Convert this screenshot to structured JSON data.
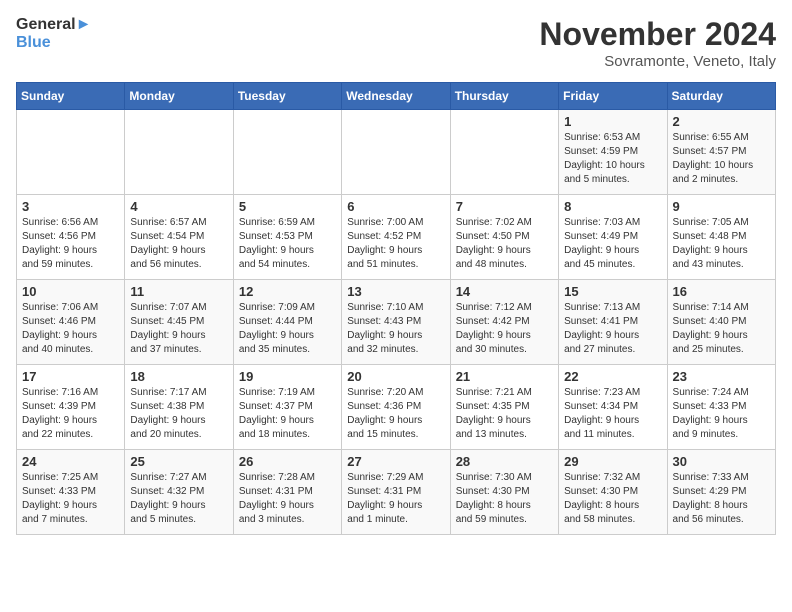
{
  "logo": {
    "line1": "General",
    "line2": "Blue"
  },
  "title": "November 2024",
  "subtitle": "Sovramonte, Veneto, Italy",
  "days_header": [
    "Sunday",
    "Monday",
    "Tuesday",
    "Wednesday",
    "Thursday",
    "Friday",
    "Saturday"
  ],
  "weeks": [
    [
      {
        "day": "",
        "info": ""
      },
      {
        "day": "",
        "info": ""
      },
      {
        "day": "",
        "info": ""
      },
      {
        "day": "",
        "info": ""
      },
      {
        "day": "",
        "info": ""
      },
      {
        "day": "1",
        "info": "Sunrise: 6:53 AM\nSunset: 4:59 PM\nDaylight: 10 hours\nand 5 minutes."
      },
      {
        "day": "2",
        "info": "Sunrise: 6:55 AM\nSunset: 4:57 PM\nDaylight: 10 hours\nand 2 minutes."
      }
    ],
    [
      {
        "day": "3",
        "info": "Sunrise: 6:56 AM\nSunset: 4:56 PM\nDaylight: 9 hours\nand 59 minutes."
      },
      {
        "day": "4",
        "info": "Sunrise: 6:57 AM\nSunset: 4:54 PM\nDaylight: 9 hours\nand 56 minutes."
      },
      {
        "day": "5",
        "info": "Sunrise: 6:59 AM\nSunset: 4:53 PM\nDaylight: 9 hours\nand 54 minutes."
      },
      {
        "day": "6",
        "info": "Sunrise: 7:00 AM\nSunset: 4:52 PM\nDaylight: 9 hours\nand 51 minutes."
      },
      {
        "day": "7",
        "info": "Sunrise: 7:02 AM\nSunset: 4:50 PM\nDaylight: 9 hours\nand 48 minutes."
      },
      {
        "day": "8",
        "info": "Sunrise: 7:03 AM\nSunset: 4:49 PM\nDaylight: 9 hours\nand 45 minutes."
      },
      {
        "day": "9",
        "info": "Sunrise: 7:05 AM\nSunset: 4:48 PM\nDaylight: 9 hours\nand 43 minutes."
      }
    ],
    [
      {
        "day": "10",
        "info": "Sunrise: 7:06 AM\nSunset: 4:46 PM\nDaylight: 9 hours\nand 40 minutes."
      },
      {
        "day": "11",
        "info": "Sunrise: 7:07 AM\nSunset: 4:45 PM\nDaylight: 9 hours\nand 37 minutes."
      },
      {
        "day": "12",
        "info": "Sunrise: 7:09 AM\nSunset: 4:44 PM\nDaylight: 9 hours\nand 35 minutes."
      },
      {
        "day": "13",
        "info": "Sunrise: 7:10 AM\nSunset: 4:43 PM\nDaylight: 9 hours\nand 32 minutes."
      },
      {
        "day": "14",
        "info": "Sunrise: 7:12 AM\nSunset: 4:42 PM\nDaylight: 9 hours\nand 30 minutes."
      },
      {
        "day": "15",
        "info": "Sunrise: 7:13 AM\nSunset: 4:41 PM\nDaylight: 9 hours\nand 27 minutes."
      },
      {
        "day": "16",
        "info": "Sunrise: 7:14 AM\nSunset: 4:40 PM\nDaylight: 9 hours\nand 25 minutes."
      }
    ],
    [
      {
        "day": "17",
        "info": "Sunrise: 7:16 AM\nSunset: 4:39 PM\nDaylight: 9 hours\nand 22 minutes."
      },
      {
        "day": "18",
        "info": "Sunrise: 7:17 AM\nSunset: 4:38 PM\nDaylight: 9 hours\nand 20 minutes."
      },
      {
        "day": "19",
        "info": "Sunrise: 7:19 AM\nSunset: 4:37 PM\nDaylight: 9 hours\nand 18 minutes."
      },
      {
        "day": "20",
        "info": "Sunrise: 7:20 AM\nSunset: 4:36 PM\nDaylight: 9 hours\nand 15 minutes."
      },
      {
        "day": "21",
        "info": "Sunrise: 7:21 AM\nSunset: 4:35 PM\nDaylight: 9 hours\nand 13 minutes."
      },
      {
        "day": "22",
        "info": "Sunrise: 7:23 AM\nSunset: 4:34 PM\nDaylight: 9 hours\nand 11 minutes."
      },
      {
        "day": "23",
        "info": "Sunrise: 7:24 AM\nSunset: 4:33 PM\nDaylight: 9 hours\nand 9 minutes."
      }
    ],
    [
      {
        "day": "24",
        "info": "Sunrise: 7:25 AM\nSunset: 4:33 PM\nDaylight: 9 hours\nand 7 minutes."
      },
      {
        "day": "25",
        "info": "Sunrise: 7:27 AM\nSunset: 4:32 PM\nDaylight: 9 hours\nand 5 minutes."
      },
      {
        "day": "26",
        "info": "Sunrise: 7:28 AM\nSunset: 4:31 PM\nDaylight: 9 hours\nand 3 minutes."
      },
      {
        "day": "27",
        "info": "Sunrise: 7:29 AM\nSunset: 4:31 PM\nDaylight: 9 hours\nand 1 minute."
      },
      {
        "day": "28",
        "info": "Sunrise: 7:30 AM\nSunset: 4:30 PM\nDaylight: 8 hours\nand 59 minutes."
      },
      {
        "day": "29",
        "info": "Sunrise: 7:32 AM\nSunset: 4:30 PM\nDaylight: 8 hours\nand 58 minutes."
      },
      {
        "day": "30",
        "info": "Sunrise: 7:33 AM\nSunset: 4:29 PM\nDaylight: 8 hours\nand 56 minutes."
      }
    ]
  ]
}
